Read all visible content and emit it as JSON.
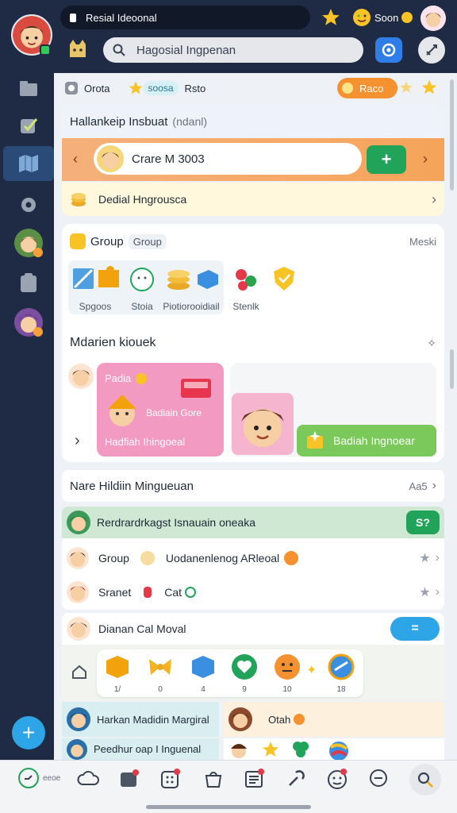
{
  "topbar": {
    "app_title": "Resial Ideoonal",
    "search_placeholder": "Hagosial Ingpenan",
    "status_label": "Soon"
  },
  "sidebar": {
    "fab_label": "+"
  },
  "quickbar": {
    "label1": "Orota",
    "label2": "soosa",
    "label3": "Rsto",
    "promo_label": "Raco"
  },
  "header": {
    "title": "Hallankeip Insbuat",
    "subtitle": "(ndanl)"
  },
  "contact_banner": {
    "name": "Crare M 3003",
    "action_label": "+"
  },
  "notice": {
    "text": "Dedial Hngrousca"
  },
  "group": {
    "title": "Group",
    "tag": "Group",
    "more_label": "Meski",
    "items": [
      {
        "label": "Spgoos"
      },
      {
        "label": "Stoia"
      },
      {
        "label": "Piotiorooidiail"
      },
      {
        "label": "Stenlk"
      },
      {
        "label": ""
      }
    ]
  },
  "featured": {
    "title": "Mdarien kiouek",
    "card1_top": "Padia",
    "card1_mid": "Badiain Gore",
    "card1_caption": "Hadfiah Ihingoeal",
    "card2_button": "Badiah Ingnoear"
  },
  "section": {
    "title": "Nare Hildiin Mingueuan",
    "meta": "Aa5"
  },
  "list": {
    "highlight": "Rerdrardrkagst Isnauain oneaka",
    "highlight_badge": "S?",
    "row1_a": "Group",
    "row1_b": "Uodanenlenog ARleoal",
    "row2_a": "Sranet",
    "row2_b": "Cat",
    "row3": "Dianan Cal Moval",
    "row3_button": "="
  },
  "tray": {
    "counts": [
      "1/",
      "0",
      "4",
      "9",
      "10",
      "18"
    ]
  },
  "bottomlist": {
    "item1": "Harkan Madidin Margiral",
    "item2": "Otah",
    "item3": "Peedhur oap I Inguenal"
  },
  "navbar": {
    "first_label": "eeoe"
  },
  "colors": {
    "dark": "#1f2a44",
    "accent_orange": "#f59f3a",
    "accent_green": "#22a35a",
    "accent_blue": "#2ea5e6",
    "pink": "#f39ac3"
  }
}
